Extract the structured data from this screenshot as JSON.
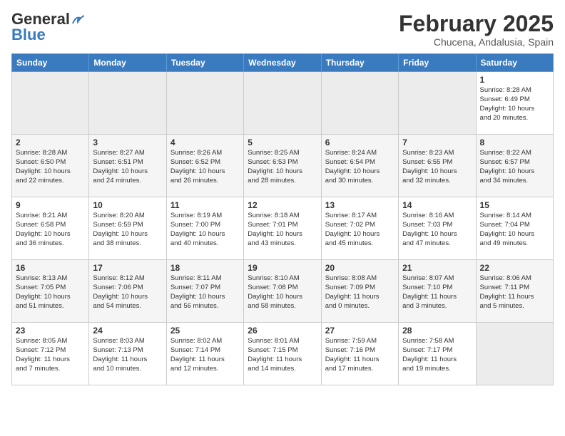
{
  "header": {
    "logo_line1": "General",
    "logo_line2": "Blue",
    "calendar_title": "February 2025",
    "calendar_subtitle": "Chucena, Andalusia, Spain"
  },
  "weekdays": [
    "Sunday",
    "Monday",
    "Tuesday",
    "Wednesday",
    "Thursday",
    "Friday",
    "Saturday"
  ],
  "weeks": [
    [
      {
        "day": "",
        "info": ""
      },
      {
        "day": "",
        "info": ""
      },
      {
        "day": "",
        "info": ""
      },
      {
        "day": "",
        "info": ""
      },
      {
        "day": "",
        "info": ""
      },
      {
        "day": "",
        "info": ""
      },
      {
        "day": "1",
        "info": "Sunrise: 8:28 AM\nSunset: 6:49 PM\nDaylight: 10 hours\nand 20 minutes."
      }
    ],
    [
      {
        "day": "2",
        "info": "Sunrise: 8:28 AM\nSunset: 6:50 PM\nDaylight: 10 hours\nand 22 minutes."
      },
      {
        "day": "3",
        "info": "Sunrise: 8:27 AM\nSunset: 6:51 PM\nDaylight: 10 hours\nand 24 minutes."
      },
      {
        "day": "4",
        "info": "Sunrise: 8:26 AM\nSunset: 6:52 PM\nDaylight: 10 hours\nand 26 minutes."
      },
      {
        "day": "5",
        "info": "Sunrise: 8:25 AM\nSunset: 6:53 PM\nDaylight: 10 hours\nand 28 minutes."
      },
      {
        "day": "6",
        "info": "Sunrise: 8:24 AM\nSunset: 6:54 PM\nDaylight: 10 hours\nand 30 minutes."
      },
      {
        "day": "7",
        "info": "Sunrise: 8:23 AM\nSunset: 6:55 PM\nDaylight: 10 hours\nand 32 minutes."
      },
      {
        "day": "8",
        "info": "Sunrise: 8:22 AM\nSunset: 6:57 PM\nDaylight: 10 hours\nand 34 minutes."
      }
    ],
    [
      {
        "day": "9",
        "info": "Sunrise: 8:21 AM\nSunset: 6:58 PM\nDaylight: 10 hours\nand 36 minutes."
      },
      {
        "day": "10",
        "info": "Sunrise: 8:20 AM\nSunset: 6:59 PM\nDaylight: 10 hours\nand 38 minutes."
      },
      {
        "day": "11",
        "info": "Sunrise: 8:19 AM\nSunset: 7:00 PM\nDaylight: 10 hours\nand 40 minutes."
      },
      {
        "day": "12",
        "info": "Sunrise: 8:18 AM\nSunset: 7:01 PM\nDaylight: 10 hours\nand 43 minutes."
      },
      {
        "day": "13",
        "info": "Sunrise: 8:17 AM\nSunset: 7:02 PM\nDaylight: 10 hours\nand 45 minutes."
      },
      {
        "day": "14",
        "info": "Sunrise: 8:16 AM\nSunset: 7:03 PM\nDaylight: 10 hours\nand 47 minutes."
      },
      {
        "day": "15",
        "info": "Sunrise: 8:14 AM\nSunset: 7:04 PM\nDaylight: 10 hours\nand 49 minutes."
      }
    ],
    [
      {
        "day": "16",
        "info": "Sunrise: 8:13 AM\nSunset: 7:05 PM\nDaylight: 10 hours\nand 51 minutes."
      },
      {
        "day": "17",
        "info": "Sunrise: 8:12 AM\nSunset: 7:06 PM\nDaylight: 10 hours\nand 54 minutes."
      },
      {
        "day": "18",
        "info": "Sunrise: 8:11 AM\nSunset: 7:07 PM\nDaylight: 10 hours\nand 56 minutes."
      },
      {
        "day": "19",
        "info": "Sunrise: 8:10 AM\nSunset: 7:08 PM\nDaylight: 10 hours\nand 58 minutes."
      },
      {
        "day": "20",
        "info": "Sunrise: 8:08 AM\nSunset: 7:09 PM\nDaylight: 11 hours\nand 0 minutes."
      },
      {
        "day": "21",
        "info": "Sunrise: 8:07 AM\nSunset: 7:10 PM\nDaylight: 11 hours\nand 3 minutes."
      },
      {
        "day": "22",
        "info": "Sunrise: 8:06 AM\nSunset: 7:11 PM\nDaylight: 11 hours\nand 5 minutes."
      }
    ],
    [
      {
        "day": "23",
        "info": "Sunrise: 8:05 AM\nSunset: 7:12 PM\nDaylight: 11 hours\nand 7 minutes."
      },
      {
        "day": "24",
        "info": "Sunrise: 8:03 AM\nSunset: 7:13 PM\nDaylight: 11 hours\nand 10 minutes."
      },
      {
        "day": "25",
        "info": "Sunrise: 8:02 AM\nSunset: 7:14 PM\nDaylight: 11 hours\nand 12 minutes."
      },
      {
        "day": "26",
        "info": "Sunrise: 8:01 AM\nSunset: 7:15 PM\nDaylight: 11 hours\nand 14 minutes."
      },
      {
        "day": "27",
        "info": "Sunrise: 7:59 AM\nSunset: 7:16 PM\nDaylight: 11 hours\nand 17 minutes."
      },
      {
        "day": "28",
        "info": "Sunrise: 7:58 AM\nSunset: 7:17 PM\nDaylight: 11 hours\nand 19 minutes."
      },
      {
        "day": "",
        "info": ""
      }
    ]
  ]
}
